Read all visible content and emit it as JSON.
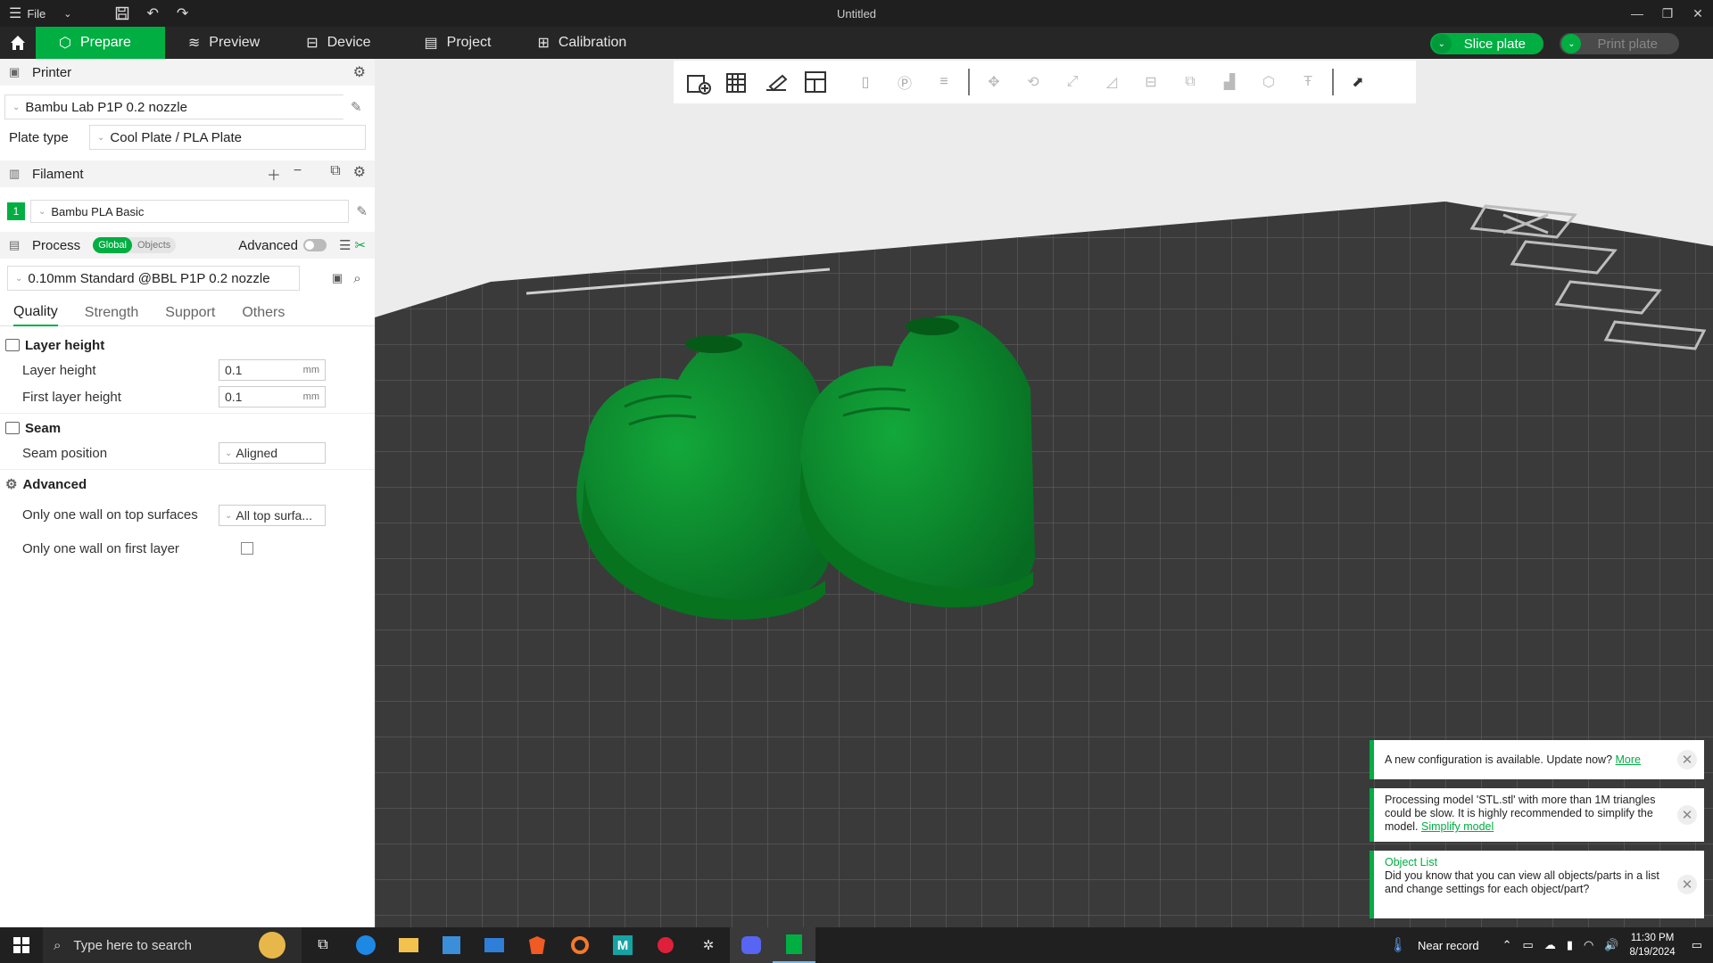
{
  "titlebar": {
    "file_label": "File",
    "title": "Untitled"
  },
  "menubar": {
    "tabs": [
      {
        "label": "Prepare"
      },
      {
        "label": "Preview"
      },
      {
        "label": "Device"
      },
      {
        "label": "Project"
      },
      {
        "label": "Calibration"
      }
    ],
    "slice_label": "Slice plate",
    "print_label": "Print plate"
  },
  "printer": {
    "header": "Printer",
    "printer_name": "Bambu Lab P1P 0.2 nozzle",
    "plate_type_label": "Plate type",
    "plate_type_value": "Cool Plate / PLA Plate"
  },
  "filament": {
    "header": "Filament",
    "slot_number": "1",
    "slot_color": "#00ae42",
    "name": "Bambu PLA Basic"
  },
  "process": {
    "header": "Process",
    "seg_global": "Global",
    "seg_objects": "Objects",
    "advanced_label": "Advanced",
    "preset": "0.10mm Standard @BBL P1P 0.2 nozzle",
    "tabs": [
      "Quality",
      "Strength",
      "Support",
      "Others"
    ]
  },
  "quality": {
    "layer_height_group": "Layer height",
    "layer_height_label": "Layer height",
    "layer_height_value": "0.1",
    "first_layer_label": "First layer height",
    "first_layer_value": "0.1",
    "unit": "mm",
    "seam_group": "Seam",
    "seam_position_label": "Seam position",
    "seam_position_value": "Aligned",
    "advanced_group": "Advanced",
    "one_wall_top_label": "Only one wall on top surfaces",
    "one_wall_top_value": "All top surfa...",
    "one_wall_first_label": "Only one wall on first layer"
  },
  "notifications": {
    "n1_text": "A new configuration is available. Update now?",
    "n1_link": "More",
    "n2_text": "Processing model 'STL.stl' with more than 1M triangles could be slow. It is highly recommended to simplify the model.",
    "n2_link": "Simplify model",
    "n3_title": "Object List",
    "n3_text": "Did you know that you can view all objects/parts in a list and change settings for each object/part?"
  },
  "taskbar": {
    "search_placeholder": "Type here to search",
    "weather": "Near record",
    "time": "11:30 PM",
    "date": "8/19/2024"
  },
  "colors": {
    "accent": "#00ae42",
    "model": "#0a8a2e"
  },
  "icons": [
    "hamburger-icon",
    "save-icon",
    "undo-icon",
    "redo-icon",
    "home-icon",
    "cube-icon",
    "layers-icon",
    "device-icon",
    "project-icon",
    "calibration-icon",
    "gear-icon",
    "edit-icon",
    "plus-icon",
    "minus-icon",
    "search-icon",
    "windows-icon"
  ]
}
